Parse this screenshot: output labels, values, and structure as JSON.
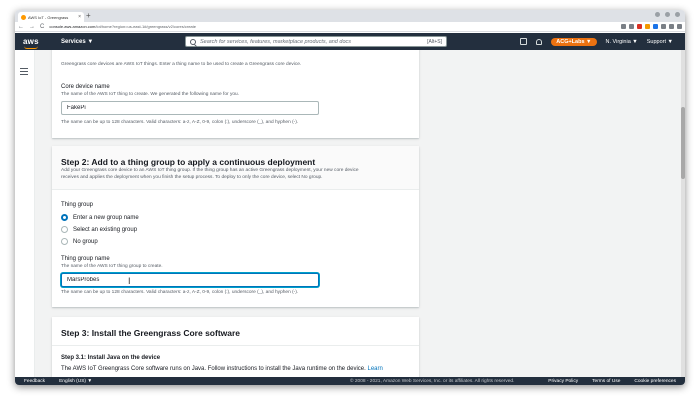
{
  "browser": {
    "tab_title": "AWS IoT - Greengrass",
    "tab_close": "×",
    "new_tab": "+",
    "nav_back": "←",
    "nav_forward": "→",
    "nav_reload": "C",
    "url_host": "console.aws.amazon.com",
    "url_path": "/iot/home?region=us-east-1#/greengrass/v2/cores/create"
  },
  "awsnav": {
    "logo": "aws",
    "services": "Services ▼",
    "search_placeholder": "Search for services, features, marketplace products, and docs",
    "search_shortcut": "[Alt+S]",
    "account": "ACG+Labs ▼",
    "region": "N. Virginia ▼",
    "support": "Support ▼"
  },
  "step1": {
    "intro": "Greengrass core devices are AWS IoT things. Enter a thing name to be used to create a Greengrass core device.",
    "core_device_label": "Core device name",
    "core_device_help": "The name of the AWS IoT thing to create. We generated the following name for you.",
    "core_device_value": "FakePi",
    "core_device_constraint": "The name can be up to 128 characters. Valid characters: a-z, A-Z, 0-9, colon (:), underscore (_), and hyphen (-)."
  },
  "step2": {
    "title": "Step 2: Add to a thing group to apply a continuous deployment",
    "description_1": "Add your Greengrass core device to an AWS IoT thing group. If the thing group has an active Greengrass deployment, your new core device",
    "description_2": "receives and applies the deployment when you finish the setup process. To deploy to only the core device, select No group.",
    "thing_group_label": "Thing group",
    "options": [
      "Enter a new group name",
      "Select an existing group",
      "No group"
    ],
    "group_name_label": "Thing group name",
    "group_name_help": "The name of the AWS IoT thing group to create.",
    "group_name_value": "MarsProbes",
    "group_name_constraint": "The name can be up to 128 characters. Valid characters: a-z, A-Z, 0-9, colon (:), underscore (_), and hyphen (-)."
  },
  "step3": {
    "title": "Step 3: Install the Greengrass Core software",
    "substep": "Step 3.1: Install Java on the device",
    "text": "The AWS IoT Greengrass Core software runs on Java. Follow instructions to install the Java runtime on the device.",
    "link": "Learn"
  },
  "footer": {
    "feedback": "Feedback",
    "language": "English (US) ▼",
    "copyright": "© 2008 - 2021, Amazon Web Services, Inc. or its affiliates. All rights reserved.",
    "privacy": "Privacy Policy",
    "terms": "Terms of Use",
    "cookies": "Cookie preferences"
  },
  "colors": {
    "nav_bg": "#232f3e",
    "accent_orange": "#ec7211",
    "link_blue": "#0073bb",
    "page_bg": "#f2f3f3"
  }
}
